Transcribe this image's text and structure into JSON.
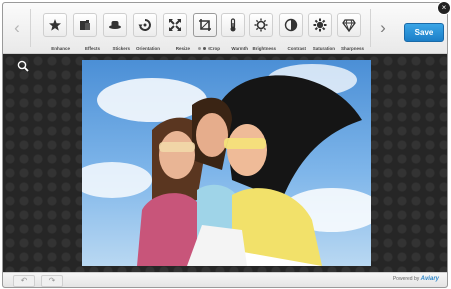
{
  "toolbar": {
    "prev_arrow": "‹",
    "next_arrow": "›",
    "save_label": "Save",
    "tools": [
      {
        "label": "Enhance",
        "icon": "enhance-icon"
      },
      {
        "label": "Effects",
        "icon": "effects-icon"
      },
      {
        "label": "Stickers",
        "icon": "stickers-icon"
      },
      {
        "label": "Orientation",
        "icon": "orientation-icon"
      },
      {
        "label": "Resize",
        "icon": "resize-icon"
      },
      {
        "label": "Crop",
        "icon": "crop-icon"
      },
      {
        "label": "Warmth",
        "icon": "warmth-icon"
      },
      {
        "label": "Brightness",
        "icon": "brightness-icon"
      },
      {
        "label": "Contrast",
        "icon": "contrast-icon"
      },
      {
        "label": "Saturation",
        "icon": "saturation-icon"
      },
      {
        "label": "Sharpness",
        "icon": "sharpness-icon"
      }
    ],
    "active_tool": "Crop",
    "page_dots": 3,
    "active_dot": 1
  },
  "close_label": "×",
  "canvas": {
    "zoom_icon": "zoom-icon"
  },
  "footer": {
    "undo_label": "↶",
    "redo_label": "↷",
    "powered_by": "Powered by",
    "brand": "Aviary"
  },
  "colors": {
    "save_button": "#2a93d9",
    "canvas_bg": "#262626",
    "brand": "#2d86c9"
  }
}
